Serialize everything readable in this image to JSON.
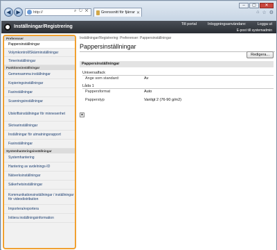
{
  "browser": {
    "address": "http://",
    "tab_title": "Grenssnitt för fjärranvändare",
    "nav_back": "◀",
    "nav_forward": "▶",
    "window_controls": {
      "minimize": "–",
      "maximize": "▢",
      "close": "✕"
    },
    "icons": {
      "home": "⌂",
      "star": "☆",
      "gear": "⚙"
    }
  },
  "header": {
    "title": "Inställningar/Registrering",
    "links": [
      "Till portal",
      "Inloggningsanvändare:",
      "Logga ut"
    ],
    "sysadmin": "E-post till systemadmin"
  },
  "sidebar": {
    "groups": [
      {
        "category": "Preferenser",
        "items": [
          "Pappersinställningar",
          "Volymkontroll/Skärminställningar",
          "Timerinställningar"
        ]
      },
      {
        "category": "Funktionsinställningar",
        "items": [
          "Gemensamma inställningar",
          "Kopieringsinställningar",
          "Faxinställningar",
          "Scanningsinställningar",
          "Utskriftsinställningar för minnesenhet",
          "Skrivarinställningar",
          "Inställningar för utmatningsrapport",
          "Faxinställningar"
        ]
      },
      {
        "category": "Systemhanteringsinställningar",
        "items": [
          "Systemhantering",
          "Hantering av avdelnings-ID",
          "Nätverksinställningar",
          "Säkerhetsinställningar",
          "Kommunikationsinställningar / inställningar för videodistribution",
          "Importera/exportera",
          "Initiera inställningsinformation"
        ]
      }
    ],
    "selected": "Pappersinställningar"
  },
  "main": {
    "breadcrumb": "Inställningar/Registrering: Preferenser: Pappersinställningar",
    "title": "Pappersinställningar",
    "edit_label": "Redigera...",
    "section_title": "Pappersinställningar",
    "groups": [
      {
        "title": "Universalfack",
        "rows": [
          {
            "k": "Ange som standard:",
            "v": "Av"
          }
        ]
      },
      {
        "title": "Låda 1",
        "rows": [
          {
            "k": "Pappersformat",
            "v": "Auto"
          },
          {
            "k": "Papperstyp",
            "v": "Vanligt 2 (76-90 g/m2)"
          }
        ]
      }
    ],
    "scroll_top": "▲"
  }
}
